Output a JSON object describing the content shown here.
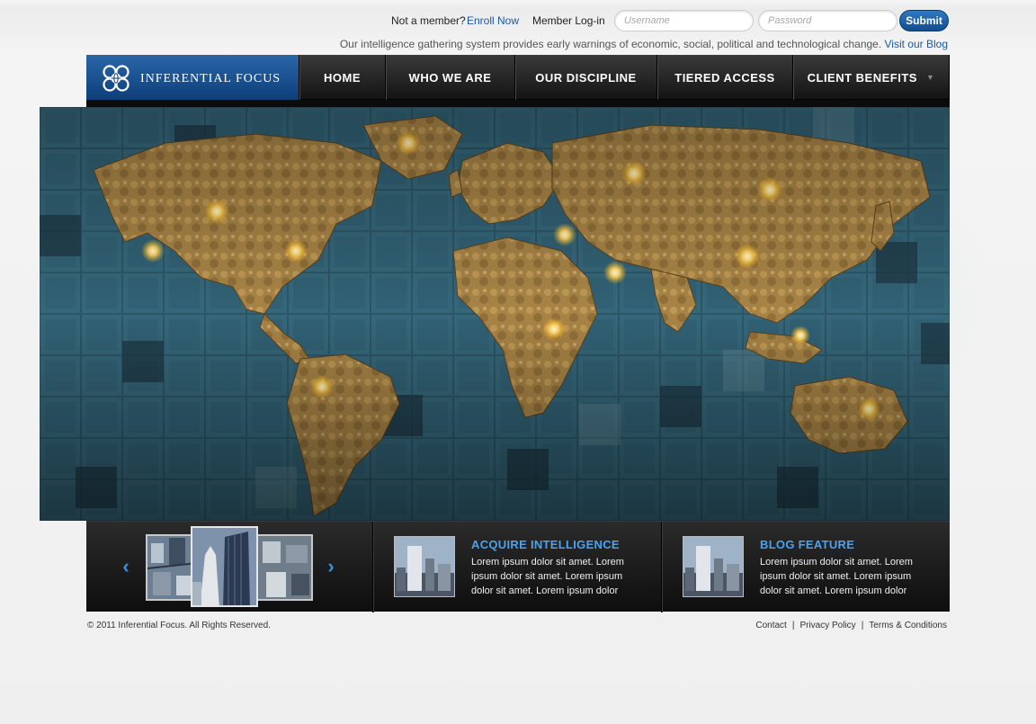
{
  "header": {
    "not_member": "Not a member?",
    "enroll": "Enroll Now",
    "member_login": "Member Log-in",
    "username_placeholder": "Username",
    "password_placeholder": "Password",
    "submit": "Submit",
    "tagline": "Our intelligence gathering system provides early warnings of economic, social, political and technological change.",
    "blog_link": "Visit our Blog"
  },
  "brand": {
    "name": "INFERENTIAL FOCUS",
    "primary_color": "#0d3f7a",
    "accent_color": "#4aa3f0"
  },
  "nav": {
    "items": [
      {
        "label": "HOME"
      },
      {
        "label": "WHO WE ARE"
      },
      {
        "label": "OUR DISCIPLINE"
      },
      {
        "label": "TIERED ACCESS"
      },
      {
        "label": "CLIENT BENEFITS"
      }
    ]
  },
  "features": [
    {
      "title": "ACQUIRE INTELLIGENCE",
      "body": "Lorem ipsum dolor sit amet. Lorem ipsum dolor sit amet. Lorem ipsum dolor sit amet. Lorem ipsum dolor"
    },
    {
      "title": "BLOG FEATURE",
      "body": "Lorem ipsum dolor sit amet. Lorem ipsum dolor sit amet. Lorem ipsum dolor sit amet. Lorem ipsum dolor"
    }
  ],
  "footer": {
    "copyright": "© 2011 Inferential Focus. All Rights Reserved.",
    "links": [
      "Contact",
      "Privacy Policy",
      "Terms & Conditions"
    ]
  }
}
